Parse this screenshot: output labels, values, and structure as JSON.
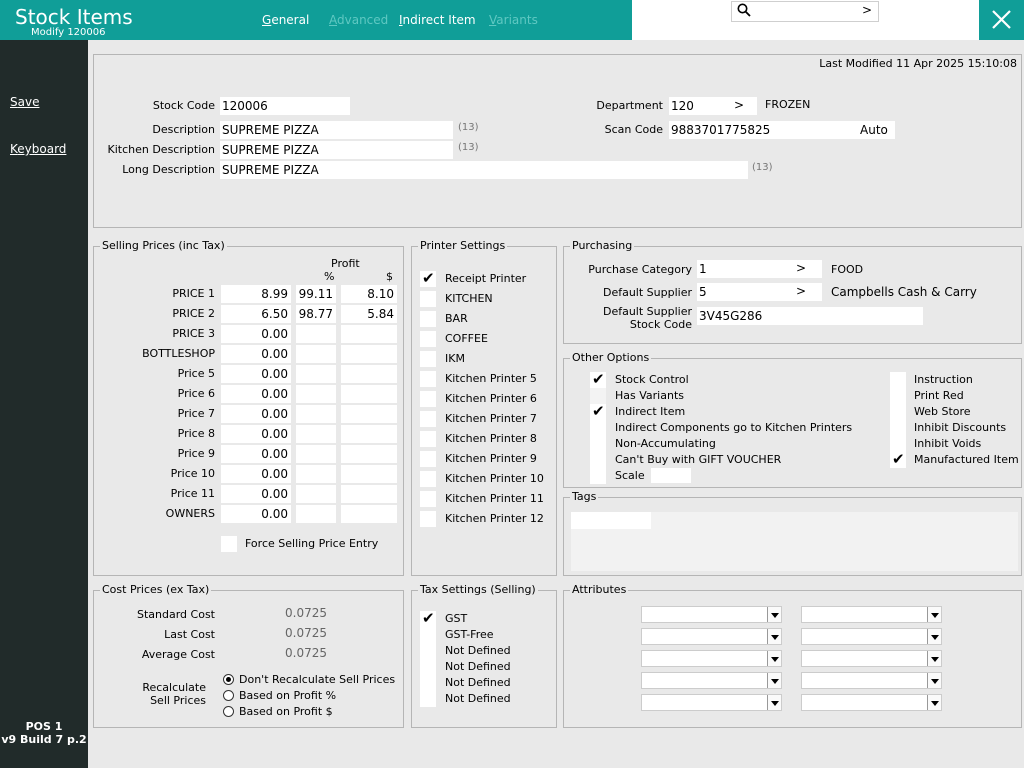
{
  "header": {
    "title": "Stock Items",
    "subtitle": "Modify 120006",
    "tabs": [
      {
        "label": "General",
        "ul": "G",
        "rest": "eneral",
        "active": true
      },
      {
        "label": "Advanced",
        "ul": "A",
        "rest": "dvanced",
        "active": false
      },
      {
        "label": "Indirect Item",
        "ul": "I",
        "rest": "ndirect Item",
        "active": true
      },
      {
        "label": "Variants",
        "ul": "V",
        "rest": "ariants",
        "active": false
      }
    ],
    "search": {
      "value": "",
      "go": ">"
    }
  },
  "sidebar": {
    "save": {
      "ul": "S",
      "rest": "ave"
    },
    "keyboard": {
      "ul": "K",
      "rest": "eyboard"
    },
    "pos": "POS 1",
    "build": "v9 Build 7 p.2"
  },
  "general": {
    "last_modified": "Last Modified 11 Apr 2025 15:10:08",
    "stock_code": {
      "label": "Stock Code",
      "value": "120006"
    },
    "description": {
      "label": "Description",
      "value": "SUPREME PIZZA",
      "count": "(13)"
    },
    "kitchen_description": {
      "label": "Kitchen Description",
      "value": "SUPREME PIZZA",
      "count": "(13)"
    },
    "long_description": {
      "label": "Long Description",
      "value": "SUPREME PIZZA",
      "count": "(13)"
    },
    "department": {
      "label": "Department",
      "value": "120",
      "go": ">",
      "name": "FROZEN"
    },
    "scan_code": {
      "label": "Scan Code",
      "value": "9883701775825",
      "auto": "Auto"
    }
  },
  "selling": {
    "title": "Selling Prices (inc Tax)",
    "profit_label": "Profit",
    "pct_label": "%",
    "dollar_label": "$",
    "rows": [
      {
        "label": "PRICE 1",
        "price": "8.99",
        "pct": "99.11",
        "dollar": "8.10"
      },
      {
        "label": "PRICE 2",
        "price": "6.50",
        "pct": "98.77",
        "dollar": "5.84"
      },
      {
        "label": "PRICE 3",
        "price": "0.00",
        "pct": "",
        "dollar": ""
      },
      {
        "label": "BOTTLESHOP",
        "price": "0.00",
        "pct": "",
        "dollar": ""
      },
      {
        "label": "Price 5",
        "price": "0.00",
        "pct": "",
        "dollar": ""
      },
      {
        "label": "Price 6",
        "price": "0.00",
        "pct": "",
        "dollar": ""
      },
      {
        "label": "Price 7",
        "price": "0.00",
        "pct": "",
        "dollar": ""
      },
      {
        "label": "Price 8",
        "price": "0.00",
        "pct": "",
        "dollar": ""
      },
      {
        "label": "Price 9",
        "price": "0.00",
        "pct": "",
        "dollar": ""
      },
      {
        "label": "Price 10",
        "price": "0.00",
        "pct": "",
        "dollar": ""
      },
      {
        "label": "Price 11",
        "price": "0.00",
        "pct": "",
        "dollar": ""
      },
      {
        "label": "OWNERS",
        "price": "0.00",
        "pct": "",
        "dollar": ""
      }
    ],
    "force_entry": "Force Selling Price Entry"
  },
  "printers": {
    "title": "Printer Settings",
    "items": [
      {
        "label": "Receipt Printer",
        "checked": true
      },
      {
        "label": "KITCHEN",
        "checked": false
      },
      {
        "label": "BAR",
        "checked": false
      },
      {
        "label": "COFFEE",
        "checked": false
      },
      {
        "label": "IKM",
        "checked": false
      },
      {
        "label": "Kitchen Printer 5",
        "checked": false
      },
      {
        "label": "Kitchen Printer 6",
        "checked": false
      },
      {
        "label": "Kitchen Printer 7",
        "checked": false
      },
      {
        "label": "Kitchen Printer 8",
        "checked": false
      },
      {
        "label": "Kitchen Printer 9",
        "checked": false
      },
      {
        "label": "Kitchen Printer 10",
        "checked": false
      },
      {
        "label": "Kitchen Printer 11",
        "checked": false
      },
      {
        "label": "Kitchen Printer 12",
        "checked": false
      }
    ]
  },
  "purchasing": {
    "title": "Purchasing",
    "category": {
      "label": "Purchase Category",
      "value": "1",
      "go": ">",
      "name": "FOOD"
    },
    "supplier": {
      "label": "Default Supplier",
      "value": "5",
      "go": ">",
      "name": "Campbells Cash & Carry"
    },
    "supplier_code": {
      "label1": "Default Supplier",
      "label2": "Stock Code",
      "value": "3V45G286"
    }
  },
  "options": {
    "title": "Other Options",
    "left": [
      {
        "label": "Stock Control",
        "checked": true,
        "disabled": false
      },
      {
        "label": "Has Variants",
        "checked": false,
        "disabled": true
      },
      {
        "label": "Indirect Item",
        "checked": true,
        "disabled": false
      },
      {
        "label": "Indirect Components go to Kitchen Printers",
        "checked": false,
        "disabled": false
      },
      {
        "label": "Non-Accumulating",
        "checked": false,
        "disabled": false
      },
      {
        "label": "Can't Buy with GIFT VOUCHER",
        "checked": false,
        "disabled": false
      },
      {
        "label": "Scale",
        "checked": false,
        "disabled": false
      }
    ],
    "right": [
      {
        "label": "Instruction",
        "checked": false
      },
      {
        "label": "Print Red",
        "checked": false
      },
      {
        "label": "Web Store",
        "checked": false
      },
      {
        "label": "Inhibit Discounts",
        "checked": false
      },
      {
        "label": "Inhibit Voids",
        "checked": false
      },
      {
        "label": "Manufactured Item",
        "checked": true
      }
    ]
  },
  "tags": {
    "title": "Tags"
  },
  "cost": {
    "title": "Cost Prices (ex Tax)",
    "standard": {
      "label": "Standard Cost",
      "value": "0.0725"
    },
    "last": {
      "label": "Last Cost",
      "value": "0.0725"
    },
    "average": {
      "label": "Average Cost",
      "value": "0.0725"
    },
    "recalc_label1": "Recalculate",
    "recalc_label2": "Sell Prices",
    "recalc_options": [
      {
        "label": "Don't Recalculate Sell Prices",
        "selected": true
      },
      {
        "label": "Based on Profit %",
        "selected": false
      },
      {
        "label": "Based on Profit $",
        "selected": false
      }
    ]
  },
  "tax": {
    "title": "Tax Settings (Selling)",
    "items": [
      {
        "label": "GST",
        "checked": true
      },
      {
        "label": "GST-Free",
        "checked": false
      },
      {
        "label": "Not Defined",
        "checked": false
      },
      {
        "label": "Not Defined",
        "checked": false
      },
      {
        "label": "Not Defined",
        "checked": false
      },
      {
        "label": "Not Defined",
        "checked": false
      }
    ]
  },
  "attributes": {
    "title": "Attributes",
    "rows": 5
  },
  "colors": {
    "accent": "#109e98",
    "sidebar": "#212b2a",
    "background": "#e9e9e9"
  }
}
